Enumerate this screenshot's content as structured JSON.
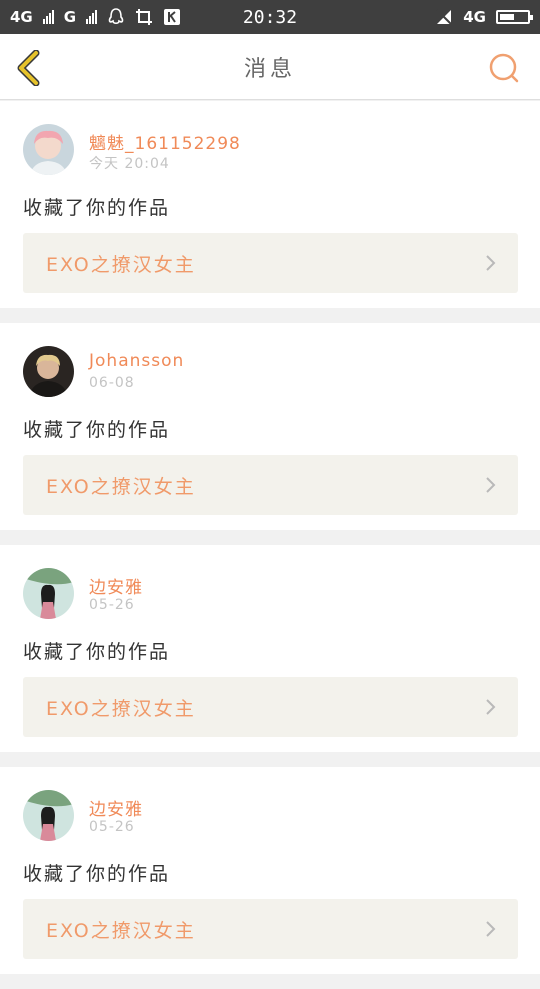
{
  "status_bar": {
    "network_left": "4G",
    "network_mid": "G",
    "time": "20:32",
    "network_right": "4G"
  },
  "header": {
    "title": "消息",
    "back_icon": "chevron-left-icon",
    "search_icon": "search-icon"
  },
  "colors": {
    "accent": "#f08a58",
    "back_icon": "#e6c22a",
    "card_bg": "#f3f2ec"
  },
  "messages": [
    {
      "user": "魑魅_161152298",
      "time": "今天 20:04",
      "action": "收藏了你的作品",
      "work": "EXO之撩汉女主"
    },
    {
      "user": "Johansson",
      "time": "06-08",
      "action": "收藏了你的作品",
      "work": "EXO之撩汉女主"
    },
    {
      "user": "边安雅",
      "time": "05-26",
      "action": "收藏了你的作品",
      "work": "EXO之撩汉女主"
    },
    {
      "user": "边安雅",
      "time": "05-26",
      "action": "收藏了你的作品",
      "work": "EXO之撩汉女主"
    }
  ]
}
